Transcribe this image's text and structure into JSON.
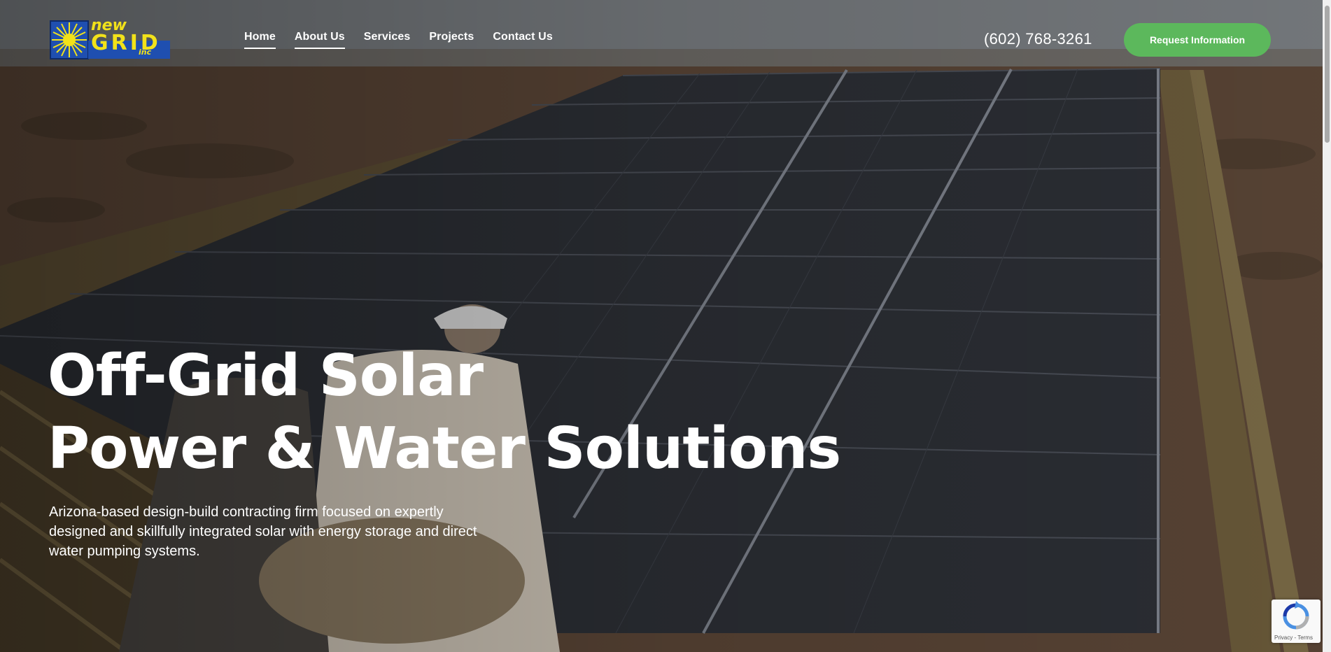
{
  "brand": {
    "logo_word_top": "new",
    "logo_word_main": "GRID",
    "logo_word_sub": "inc",
    "accent_yellow": "#f2e21a",
    "accent_blue": "#1f4fb0"
  },
  "nav": {
    "items": [
      {
        "label": "Home"
      },
      {
        "label": "About Us"
      },
      {
        "label": "Services"
      },
      {
        "label": "Projects"
      },
      {
        "label": "Contact Us"
      }
    ]
  },
  "header": {
    "phone": "(602) 768-3261",
    "cta_label": "Request Information",
    "cta_color": "#5cb85c"
  },
  "hero": {
    "title_line1": "Off-Grid Solar",
    "title_line2": "Power & Water Solutions",
    "description": "Arizona-based design-build contracting firm focused on expertly designed and skillfully integrated solar with energy storage and direct water pumping systems."
  },
  "recaptcha": {
    "icon": "recaptcha-icon",
    "links": "Privacy - Terms"
  }
}
